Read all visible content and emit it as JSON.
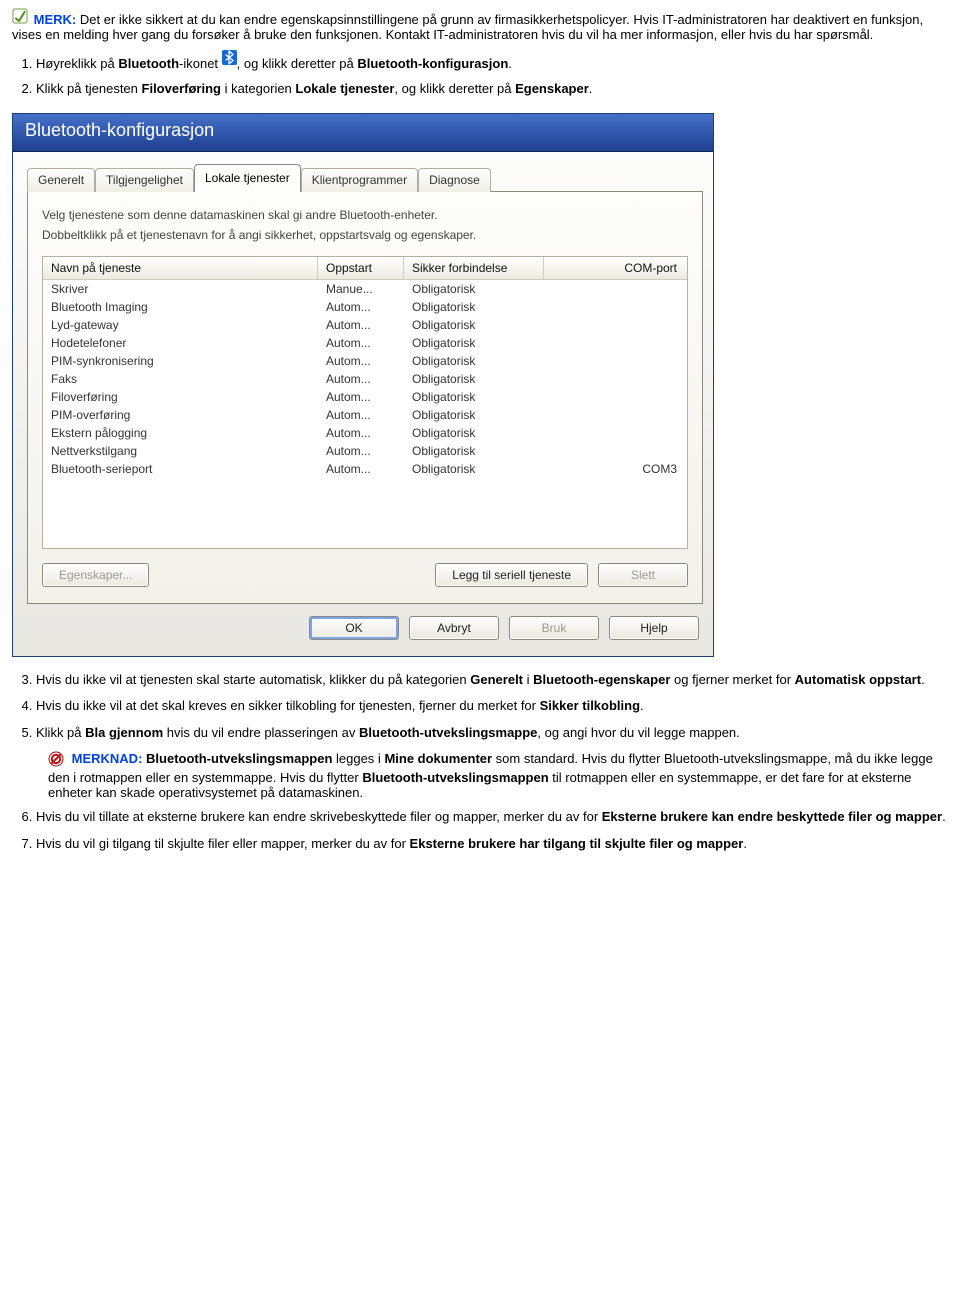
{
  "merk": {
    "label": "MERK:",
    "text": "Det er ikke sikkert at du kan endre egenskapsinnstillingene på grunn av firmasikkerhetspolicyer. Hvis IT-administratoren har deaktivert en funksjon, vises en melding hver gang du forsøker å bruke den funksjonen. Kontakt IT-administratoren hvis du vil ha mer informasjon, eller hvis du har spørsmål."
  },
  "step1": {
    "prefix": "Høyreklikk på ",
    "bt_word": "Bluetooth",
    "mid": "-ikonet ",
    "suffix": ", og klikk deretter på ",
    "target": "Bluetooth-konfigurasjon",
    "dot": "."
  },
  "step2": {
    "prefix": "Klikk på tjenesten ",
    "svc": "Filoverføring",
    "mid1": " i kategorien ",
    "cat": "Lokale tjenester",
    "mid2": ", og klikk deretter på ",
    "prop": "Egenskaper",
    "dot": "."
  },
  "dialog": {
    "title": "Bluetooth-konfigurasjon",
    "tabs": [
      "Generelt",
      "Tilgjengelighet",
      "Lokale tjenester",
      "Klientprogrammer",
      "Diagnose"
    ],
    "active_tab_index": 2,
    "desc1": "Velg tjenestene som denne datamaskinen skal gi andre Bluetooth-enheter.",
    "desc2": "Dobbeltklikk på et tjenestenavn for å angi sikkerhet, oppstartsvalg og egenskaper.",
    "columns": [
      "Navn på tjeneste",
      "Oppstart",
      "Sikker forbindelse",
      "COM-port"
    ],
    "rows": [
      {
        "name": "Skriver",
        "start": "Manue...",
        "sec": "Obligatorisk",
        "com": ""
      },
      {
        "name": "Bluetooth Imaging",
        "start": "Autom...",
        "sec": "Obligatorisk",
        "com": ""
      },
      {
        "name": "Lyd-gateway",
        "start": "Autom...",
        "sec": "Obligatorisk",
        "com": ""
      },
      {
        "name": "Hodetelefoner",
        "start": "Autom...",
        "sec": "Obligatorisk",
        "com": ""
      },
      {
        "name": "PIM-synkronisering",
        "start": "Autom...",
        "sec": "Obligatorisk",
        "com": ""
      },
      {
        "name": "Faks",
        "start": "Autom...",
        "sec": "Obligatorisk",
        "com": ""
      },
      {
        "name": "Filoverføring",
        "start": "Autom...",
        "sec": "Obligatorisk",
        "com": ""
      },
      {
        "name": "PIM-overføring",
        "start": "Autom...",
        "sec": "Obligatorisk",
        "com": ""
      },
      {
        "name": "Ekstern pålogging",
        "start": "Autom...",
        "sec": "Obligatorisk",
        "com": ""
      },
      {
        "name": "Nettverkstilgang",
        "start": "Autom...",
        "sec": "Obligatorisk",
        "com": ""
      },
      {
        "name": "Bluetooth-serieport",
        "start": "Autom...",
        "sec": "Obligatorisk",
        "com": "COM3"
      }
    ],
    "buttons": {
      "props": "Egenskaper...",
      "add_serial": "Legg til seriell tjeneste",
      "delete": "Slett",
      "ok": "OK",
      "cancel": "Avbryt",
      "apply": "Bruk",
      "help": "Hjelp"
    }
  },
  "step3": {
    "prefix": "Hvis du ikke vil at tjenesten skal starte automatisk, klikker du på kategorien ",
    "gen": "Generelt",
    "mid1": " i ",
    "bt_props": "Bluetooth-egenskaper",
    "mid2": " og fjerner merket for ",
    "auto": "Automatisk oppstart",
    "dot": "."
  },
  "step4": {
    "prefix": "Hvis du ikke vil at det skal kreves en sikker tilkobling for tjenesten, fjerner du merket for ",
    "sikker": "Sikker tilkobling",
    "dot": "."
  },
  "step5": {
    "prefix": "Klikk på ",
    "browse": "Bla gjennom",
    "mid1": " hvis du vil endre plasseringen av ",
    "bt_folder": "Bluetooth-utvekslingsmappe",
    "suffix": ", og angi hvor du vil legge mappen."
  },
  "merknad": {
    "label": "MERKNAD:",
    "lead": " ",
    "b1": "Bluetooth-utvekslingsmappen",
    "t1": " legges i ",
    "b2": "Mine dokumenter",
    "t2": " som standard. Hvis du flytter Bluetooth-utvekslingsmappe, må du ikke legge den i rotmappen eller en systemmappe. Hvis du flytter ",
    "b3": "Bluetooth-utvekslingsmappen",
    "t3": " til rotmappen eller en systemmappe, er det fare for at eksterne enheter kan skade operativsystemet på datamaskinen."
  },
  "step6": {
    "prefix": "Hvis du vil tillate at eksterne brukere kan endre skrivebeskyttede filer og mapper, merker du av for ",
    "label": "Eksterne brukere kan endre beskyttede filer og mapper",
    "dot": "."
  },
  "step7": {
    "prefix": "Hvis du vil gi tilgang til skjulte filer eller mapper, merker du av for ",
    "label": "Eksterne brukere har tilgang til skjulte filer og mapper",
    "dot": "."
  }
}
